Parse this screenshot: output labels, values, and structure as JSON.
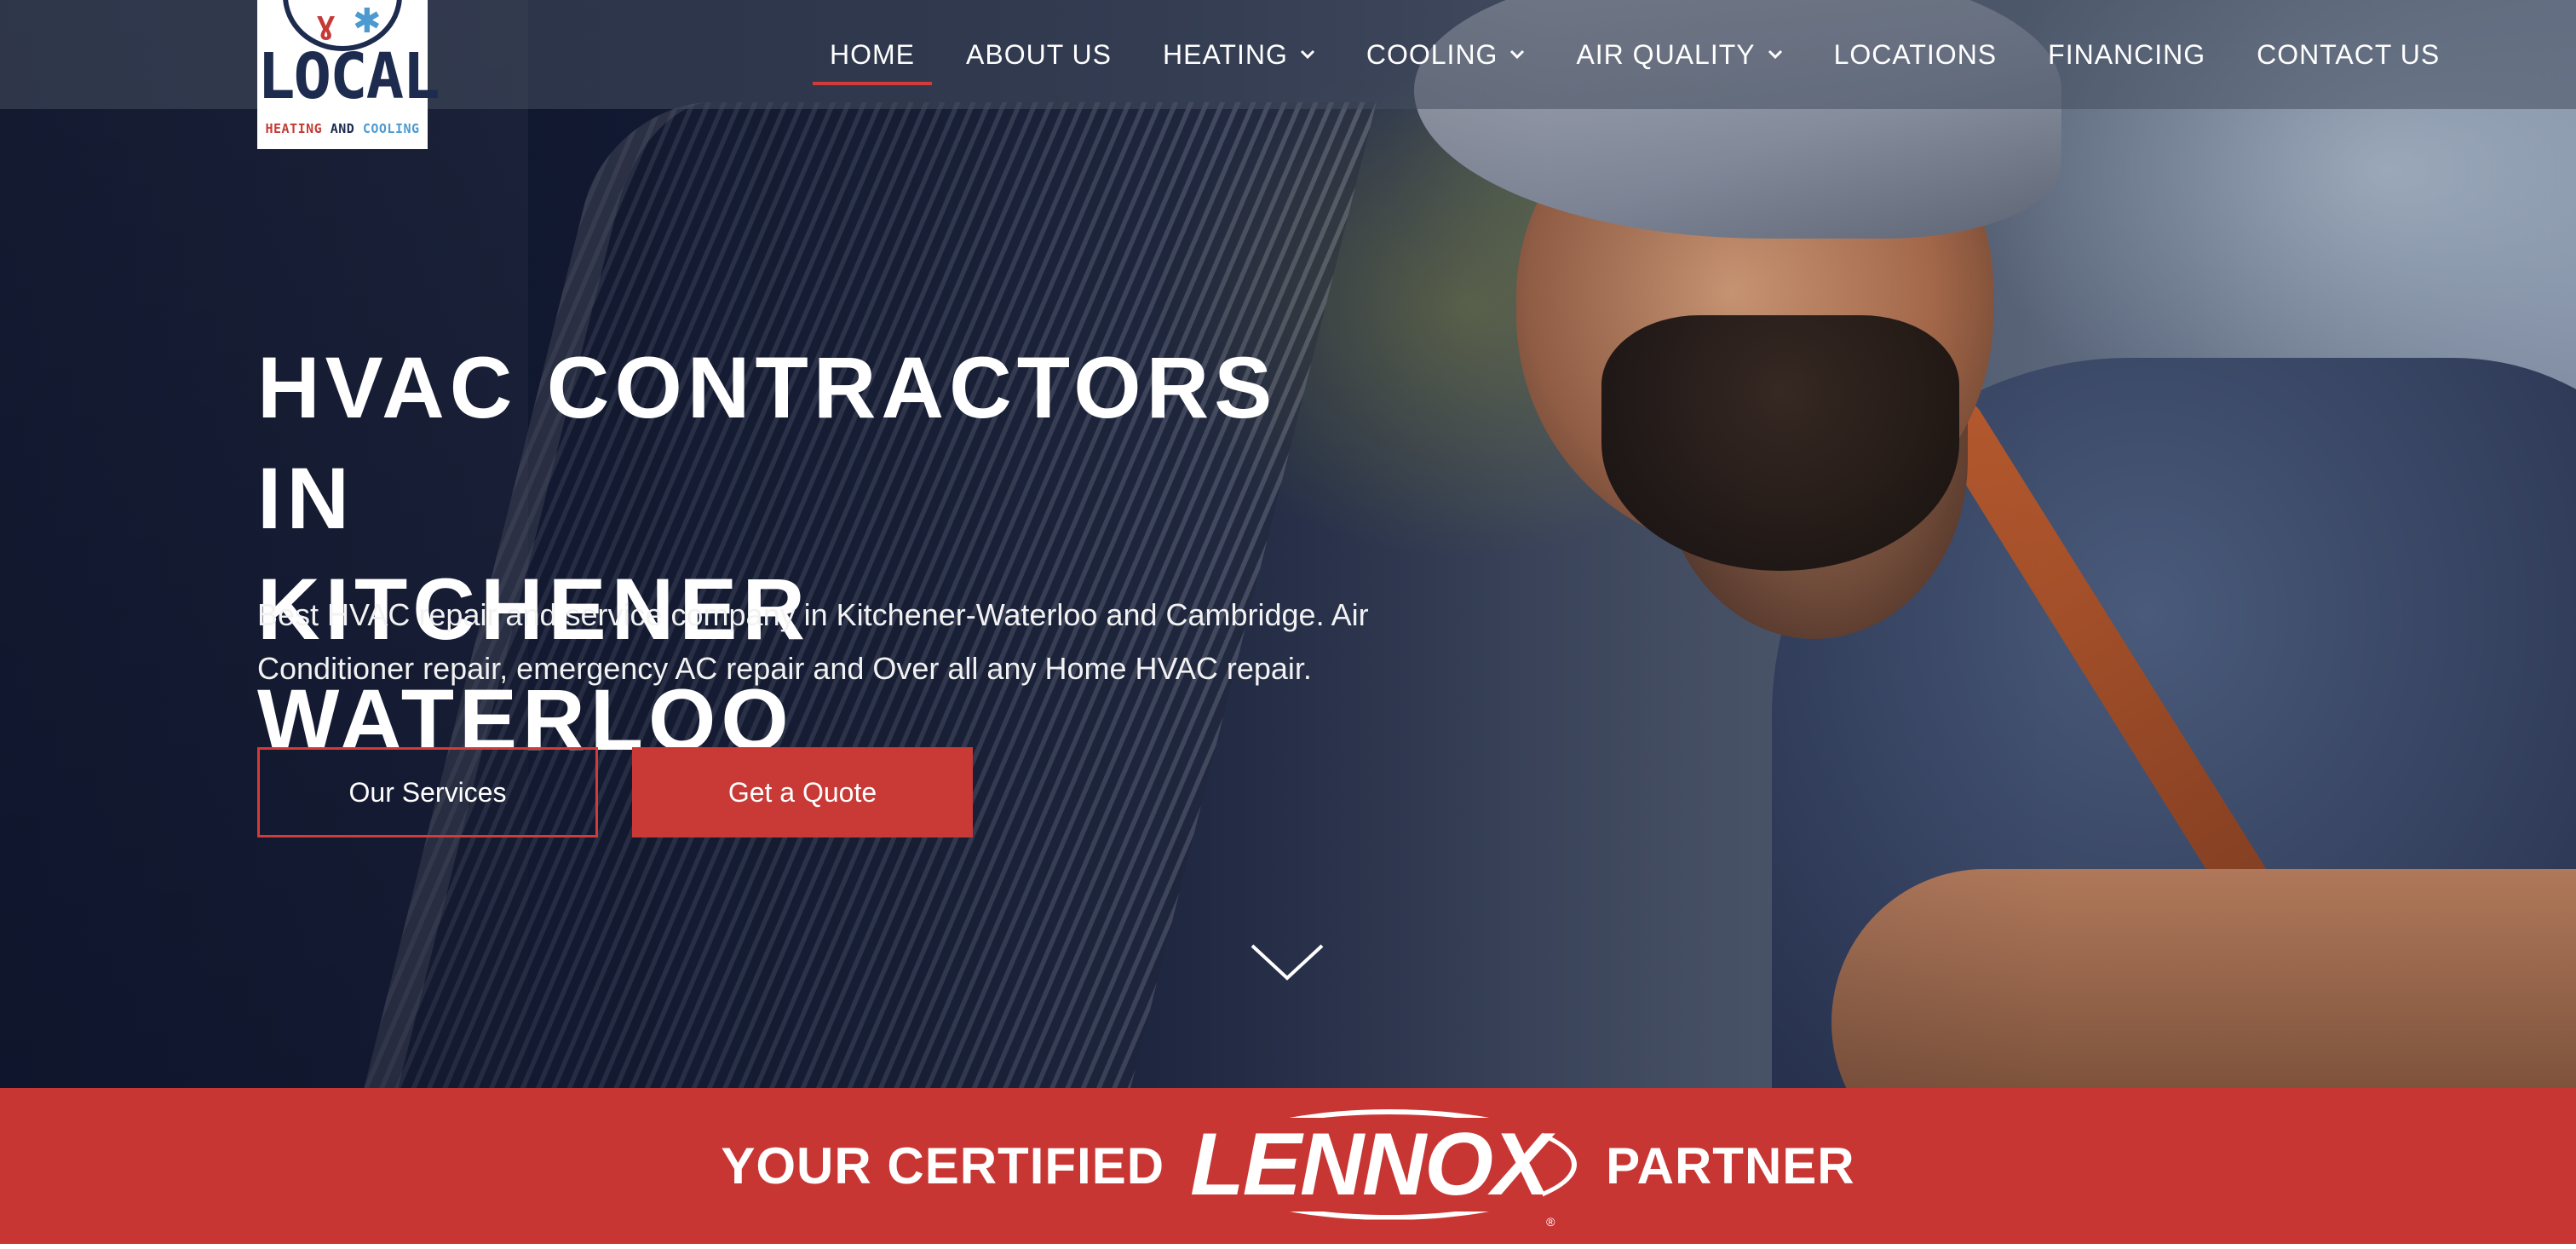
{
  "brand": {
    "logo_word": "LOCAL",
    "logo_tagline_1": "HEATING",
    "logo_tagline_2": "AND",
    "logo_tagline_3": "COOLING"
  },
  "nav": {
    "items": [
      {
        "label": "HOME",
        "active": true,
        "dropdown": false
      },
      {
        "label": "ABOUT US",
        "active": false,
        "dropdown": false
      },
      {
        "label": "HEATING",
        "active": false,
        "dropdown": true
      },
      {
        "label": "COOLING",
        "active": false,
        "dropdown": true
      },
      {
        "label": "AIR QUALITY",
        "active": false,
        "dropdown": true
      },
      {
        "label": "LOCATIONS",
        "active": false,
        "dropdown": false
      },
      {
        "label": "FINANCING",
        "active": false,
        "dropdown": false
      },
      {
        "label": "CONTACT US",
        "active": false,
        "dropdown": false
      }
    ]
  },
  "hero": {
    "title_line_1": "HVAC CONTRACTORS IN",
    "title_line_2": "KITCHENER WATERLOO",
    "subtitle_line_1": "Best HVAC repair and service company in Kitchener-Waterloo and Cambridge. Air",
    "subtitle_line_2": "Conditioner repair, emergency AC repair and Over all any Home HVAC repair.",
    "primary_cta": "Get a Quote",
    "secondary_cta": "Our Services"
  },
  "band": {
    "left_text": "YOUR CERTIFIED",
    "logo_text": "LENNOX",
    "logo_mark": "®",
    "right_text": "PARTNER"
  },
  "colors": {
    "accent_red": "#c83634",
    "nav_underline": "#d33b38",
    "logo_navy": "#1d2b4f",
    "logo_blue": "#4d9ad0"
  },
  "icons": {
    "dropdown": "chevron-down-icon",
    "scroll": "chevron-down-thin-icon"
  }
}
